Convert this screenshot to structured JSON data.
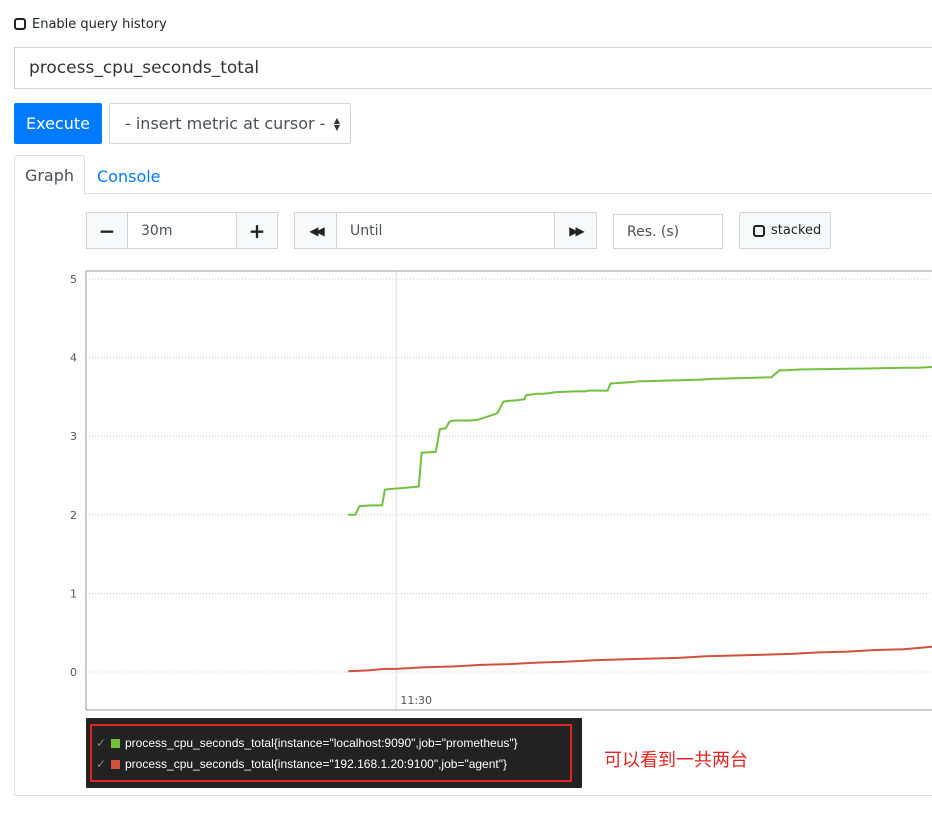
{
  "query_history": {
    "label": "Enable query history",
    "checked": false
  },
  "query": {
    "value": "process_cpu_seconds_total"
  },
  "toolbar": {
    "execute_label": "Execute",
    "insert_metric_label": "- insert metric at cursor -"
  },
  "tabs": [
    {
      "label": "Graph",
      "active": true
    },
    {
      "label": "Console",
      "active": false
    }
  ],
  "graph_controls": {
    "minus_label": "−",
    "range_value": "30m",
    "plus_label": "+",
    "back_label": "◀◀",
    "until_placeholder": "Until",
    "forward_label": "▶▶",
    "res_placeholder": "Res. (s)",
    "stacked_label": "stacked",
    "stacked_checked": false
  },
  "chart_data": {
    "type": "line",
    "ylim": [
      0,
      5
    ],
    "y_ticks": [
      0,
      1,
      2,
      3,
      4,
      5
    ],
    "x_ticks": [
      {
        "label": "11:30",
        "minute": 11.0
      }
    ],
    "x_range_minutes": [
      0,
      30
    ],
    "series": [
      {
        "name": "process_cpu_seconds_total{instance=\"localhost:9090\",job=\"prometheus\"}",
        "color": "#73bf3e",
        "x": [
          9.3,
          9.55,
          9.7,
          10.1,
          10.5,
          10.6,
          10.85,
          11.2,
          11.8,
          11.9,
          12.4,
          12.55,
          12.75,
          12.9,
          13.05,
          13.4,
          13.6,
          13.9,
          14.5,
          14.6,
          14.8,
          15.0,
          15.1,
          15.35,
          15.55,
          15.6,
          16.0,
          16.2,
          16.5,
          16.6,
          17.3,
          17.7,
          17.8,
          18.5,
          18.6,
          19.4,
          19.6,
          19.8,
          20.8,
          20.95,
          21.8,
          22.3,
          22.4,
          24.3,
          24.6,
          24.8,
          25.4,
          25.6,
          27.3,
          27.5,
          29.0,
          29.5,
          30.0
        ],
        "y": [
          2.0,
          2.0,
          2.11,
          2.12,
          2.12,
          2.32,
          2.33,
          2.34,
          2.36,
          2.79,
          2.8,
          3.09,
          3.1,
          3.19,
          3.2,
          3.2,
          3.2,
          3.21,
          3.28,
          3.3,
          3.44,
          3.45,
          3.45,
          3.46,
          3.47,
          3.52,
          3.54,
          3.54,
          3.55,
          3.56,
          3.57,
          3.57,
          3.58,
          3.58,
          3.67,
          3.69,
          3.7,
          3.7,
          3.71,
          3.71,
          3.72,
          3.73,
          3.73,
          3.75,
          3.84,
          3.84,
          3.85,
          3.85,
          3.86,
          3.86,
          3.87,
          3.87,
          3.88
        ]
      },
      {
        "name": "process_cpu_seconds_total{instance=\"192.168.1.20:9100\",job=\"agent\"}",
        "color": "#d0513c",
        "x": [
          9.3,
          10.0,
          10.6,
          11.0,
          12.0,
          13.0,
          14.0,
          15.0,
          16.0,
          17.0,
          18.0,
          19.0,
          20.0,
          21.0,
          22.0,
          23.0,
          24.0,
          25.0,
          26.0,
          27.0,
          28.0,
          29.0,
          30.0
        ],
        "y": [
          0.01,
          0.02,
          0.04,
          0.04,
          0.06,
          0.07,
          0.09,
          0.1,
          0.12,
          0.13,
          0.15,
          0.16,
          0.17,
          0.18,
          0.2,
          0.21,
          0.22,
          0.23,
          0.25,
          0.26,
          0.28,
          0.29,
          0.32
        ]
      }
    ]
  },
  "legend": {
    "check_glyph": "✓",
    "items": [
      {
        "label": "process_cpu_seconds_total{instance=\"localhost:9090\",job=\"prometheus\"}",
        "color": "#73bf3e"
      },
      {
        "label": "process_cpu_seconds_total{instance=\"192.168.1.20:9100\",job=\"agent\"}",
        "color": "#d0513c"
      }
    ]
  },
  "annotation": {
    "text": "可以看到一共两台",
    "color": "#e02424"
  },
  "colors": {
    "primary": "#007bff",
    "border": "#ced4da",
    "legend_bg": "#222222",
    "highlight": "#e02424"
  }
}
